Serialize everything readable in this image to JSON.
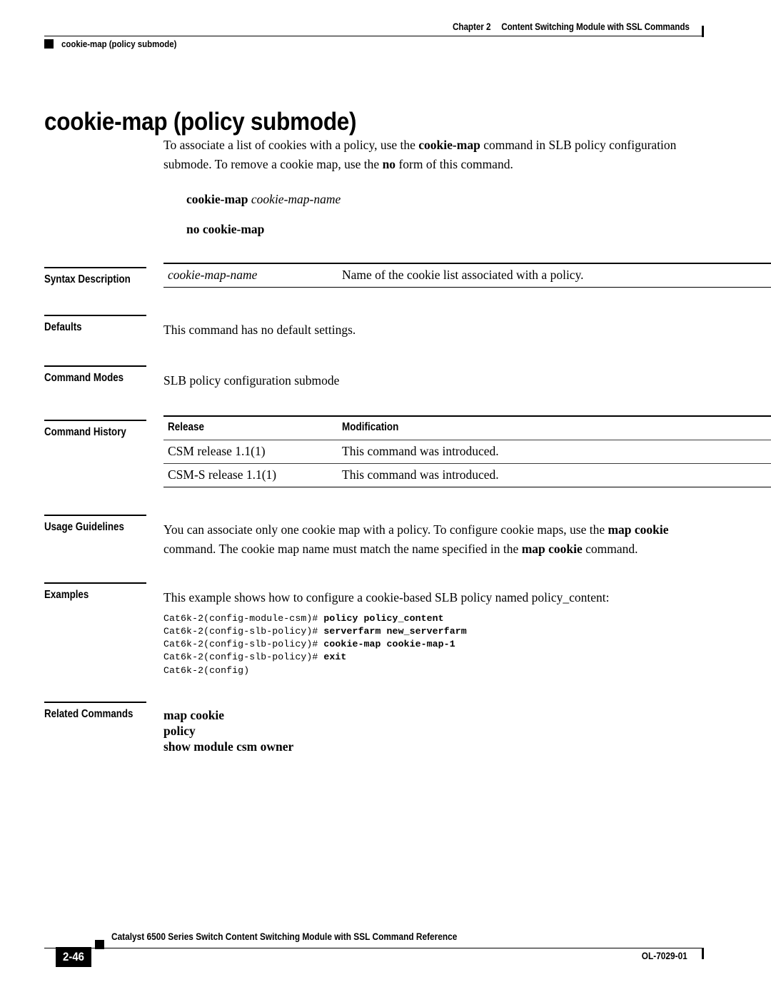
{
  "header": {
    "chapter_label": "Chapter",
    "chapter_number": "2",
    "chapter_title": "Content Switching Module with SSL Commands",
    "running_command": "cookie-map (policy submode)"
  },
  "page_title": "cookie-map (policy submode)",
  "intro": {
    "paragraph": "To associate a list of cookies with a policy, use the cookie-map command in SLB policy configuration submode. To remove a cookie map, use the no form of this command.",
    "p_part1": "To associate a list of cookies with a policy, use the ",
    "p_bold1": "cookie-map",
    "p_part2": " command in SLB policy configuration submode. To remove a cookie map, use the ",
    "p_bold2": "no",
    "p_part3": " form of this command."
  },
  "syntax_lines": [
    {
      "command": "cookie-map",
      "argument": "cookie-map-name"
    },
    {
      "command": "no cookie-map",
      "argument": ""
    }
  ],
  "sections": {
    "syntax_description": {
      "label": "Syntax Description",
      "rows": [
        {
          "term": "cookie-map-name",
          "description": "Name of the cookie list associated with a policy."
        }
      ]
    },
    "defaults": {
      "label": "Defaults",
      "text": "This command has no default settings."
    },
    "command_modes": {
      "label": "Command Modes",
      "text": "SLB policy configuration submode"
    },
    "command_history": {
      "label": "Command History",
      "columns": [
        "Release",
        "Modification"
      ],
      "rows": [
        [
          "CSM release 1.1(1)",
          "This command was introduced."
        ],
        [
          "CSM-S release 1.1(1)",
          "This command was introduced."
        ]
      ]
    },
    "usage_guidelines": {
      "label": "Usage Guidelines",
      "part1": "You can associate only one cookie map with a policy. To configure cookie maps, use the ",
      "bold1": "map cookie",
      "part2": " command. The cookie map name must match the name specified in the ",
      "bold2": "map cookie",
      "part3": " command."
    },
    "examples": {
      "label": "Examples",
      "intro": "This example shows how to configure a cookie-based SLB policy named policy_content:",
      "cli_lines": [
        {
          "prompt": "Cat6k-2(config-module-csm)# ",
          "command": "policy policy_content"
        },
        {
          "prompt": "Cat6k-2(config-slb-policy)# ",
          "command": "serverfarm new_serverfarm"
        },
        {
          "prompt": "Cat6k-2(config-slb-policy)# ",
          "command": "cookie-map cookie-map-1"
        },
        {
          "prompt": "Cat6k-2(config-slb-policy)# ",
          "command": "exit"
        },
        {
          "prompt": "Cat6k-2(config)",
          "command": ""
        }
      ]
    },
    "related_commands": {
      "label": "Related Commands",
      "items": [
        "map cookie",
        "policy",
        "show module csm owner"
      ]
    }
  },
  "footer": {
    "book_title": "Catalyst 6500 Series Switch Content Switching Module with SSL Command Reference",
    "page_number": "2-46",
    "doc_id": "OL-7029-01"
  },
  "colors": {
    "text": "#000000",
    "rule": "#000000",
    "background": "#ffffff"
  }
}
